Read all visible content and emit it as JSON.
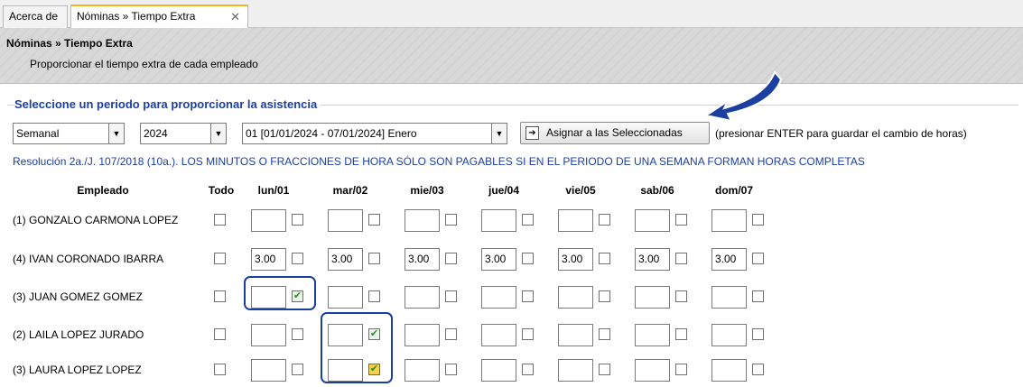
{
  "tabs": [
    {
      "label": "Acerca de"
    },
    {
      "label": "Nóminas » Tiempo Extra",
      "close": "✕"
    }
  ],
  "header": {
    "title": "Nóminas » Tiempo Extra",
    "subtitle": "Proporcionar el tiempo extra de cada empleado"
  },
  "fieldset": {
    "legend": "Seleccione un periodo para proporcionar la asistencia"
  },
  "filters": {
    "period_type": "Semanal",
    "year": "2024",
    "period": "01 [01/01/2024 - 07/01/2024] Enero",
    "assign_button": "Asignar a las Seleccionadas",
    "hint": "(presionar ENTER para guardar el cambio de horas)"
  },
  "notice": "Resolución 2a./J. 107/2018 (10a.). LOS MINUTOS O FRACCIONES DE HORA SÓLO SON PAGABLES SI EN EL PERIODO DE UNA SEMANA FORMAN HORAS COMPLETAS",
  "columns": {
    "employee": "Empleado",
    "all": "Todo",
    "days": [
      "lun/01",
      "mar/02",
      "mie/03",
      "jue/04",
      "vie/05",
      "sab/06",
      "dom/07"
    ]
  },
  "rows": [
    {
      "name": "(1) GONZALO CARMONA LOPEZ",
      "hours": [
        "",
        "",
        "",
        "",
        "",
        "",
        ""
      ]
    },
    {
      "name": "(4) IVAN CORONADO IBARRA",
      "hours": [
        "3.00",
        "3.00",
        "3.00",
        "3.00",
        "3.00",
        "3.00",
        "3.00"
      ]
    },
    {
      "name": "(3) JUAN GOMEZ GOMEZ",
      "hours": [
        "",
        "",
        "",
        "",
        "",
        "",
        ""
      ]
    },
    {
      "name": "(2) LAILA LOPEZ JURADO",
      "hours": [
        "",
        "",
        "",
        "",
        "",
        "",
        ""
      ]
    },
    {
      "name": "(3) LAURA LOPEZ LOPEZ",
      "hours": [
        "",
        "",
        "",
        "",
        "",
        "",
        ""
      ]
    }
  ],
  "colors": {
    "accent": "#1c3fa5",
    "highlight": "#1b3fa0",
    "check": "#2a8a2a"
  },
  "icons": {
    "dropdown": "chevron-down-icon",
    "assign": "assign-arrow-icon",
    "check": "check-icon",
    "close": "close-icon",
    "pointer": "pointer-arrow-icon"
  }
}
